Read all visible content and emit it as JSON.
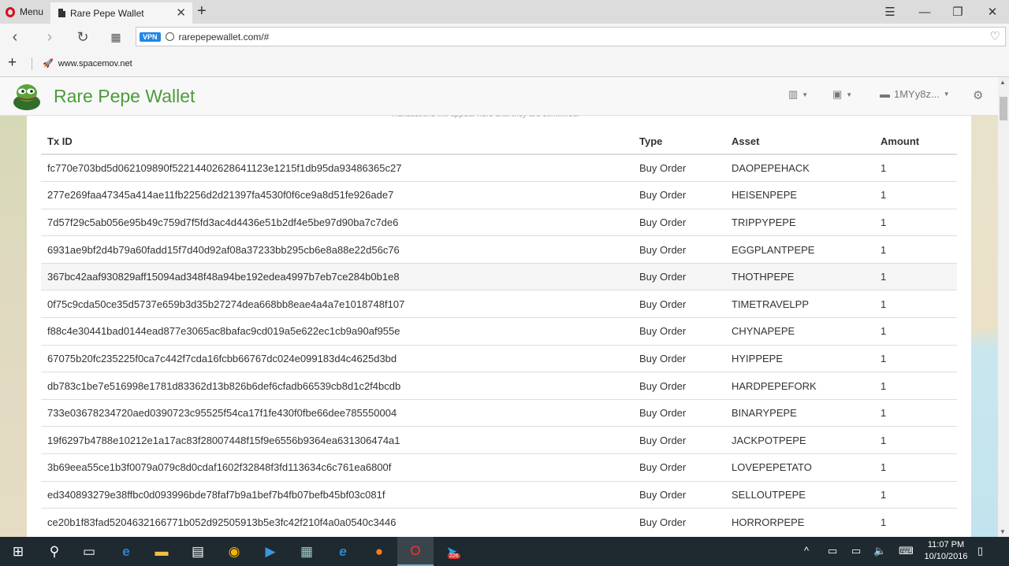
{
  "browser": {
    "menu_label": "Menu",
    "tab_title": "Rare Pepe Wallet",
    "url": "rarepepewallet.com/#",
    "vpn_label": "VPN",
    "bookmark": "www.spacemov.net"
  },
  "app": {
    "title": "Rare Pepe Wallet",
    "address_label": "1MYy8z...",
    "cut_text": "Transactions will appear here until they are confirmed."
  },
  "table": {
    "headers": [
      "Tx ID",
      "Type",
      "Asset",
      "Amount"
    ],
    "rows": [
      {
        "txid": "fc770e703bd5d062109890f52214402628641123e1215f1db95da93486365c27",
        "type": "Buy Order",
        "asset": "DAOPEPEHACK",
        "amount": "1"
      },
      {
        "txid": "277e269faa47345a414ae11fb2256d2d21397fa4530f0f6ce9a8d51fe926ade7",
        "type": "Buy Order",
        "asset": "HEISENPEPE",
        "amount": "1"
      },
      {
        "txid": "7d57f29c5ab056e95b49c759d7f5fd3ac4d4436e51b2df4e5be97d90ba7c7de6",
        "type": "Buy Order",
        "asset": "TRIPPYPEPE",
        "amount": "1"
      },
      {
        "txid": "6931ae9bf2d4b79a60fadd15f7d40d92af08a37233bb295cb6e8a88e22d56c76",
        "type": "Buy Order",
        "asset": "EGGPLANTPEPE",
        "amount": "1"
      },
      {
        "txid": "367bc42aaf930829aff15094ad348f48a94be192edea4997b7eb7ce284b0b1e8",
        "type": "Buy Order",
        "asset": "THOTHPEPE",
        "amount": "1"
      },
      {
        "txid": "0f75c9cda50ce35d5737e659b3d35b27274dea668bb8eae4a4a7e1018748f107",
        "type": "Buy Order",
        "asset": "TIMETRAVELPP",
        "amount": "1"
      },
      {
        "txid": "f88c4e30441bad0144ead877e3065ac8bafac9cd019a5e622ec1cb9a90af955e",
        "type": "Buy Order",
        "asset": "CHYNAPEPE",
        "amount": "1"
      },
      {
        "txid": "67075b20fc235225f0ca7c442f7cda16fcbb66767dc024e099183d4c4625d3bd",
        "type": "Buy Order",
        "asset": "HYIPPEPE",
        "amount": "1"
      },
      {
        "txid": "db783c1be7e516998e1781d83362d13b826b6def6cfadb66539cb8d1c2f4bcdb",
        "type": "Buy Order",
        "asset": "HARDPEPEFORK",
        "amount": "1"
      },
      {
        "txid": "733e03678234720aed0390723c95525f54ca17f1fe430f0fbe66dee785550004",
        "type": "Buy Order",
        "asset": "BINARYPEPE",
        "amount": "1"
      },
      {
        "txid": "19f6297b4788e10212e1a17ac83f28007448f15f9e6556b9364ea631306474a1",
        "type": "Buy Order",
        "asset": "JACKPOTPEPE",
        "amount": "1"
      },
      {
        "txid": "3b69eea55ce1b3f0079a079c8d0cdaf1602f32848f3fd113634c6c761ea6800f",
        "type": "Buy Order",
        "asset": "LOVEPEPETATO",
        "amount": "1"
      },
      {
        "txid": "ed340893279e38ffbc0d093996bde78faf7b9a1bef7b4fb07befb45bf03c081f",
        "type": "Buy Order",
        "asset": "SELLOUTPEPE",
        "amount": "1"
      },
      {
        "txid": "ce20b1f83fad5204632166771b052d92505913b5e3fc42f210f4a0a0540c3446",
        "type": "Buy Order",
        "asset": "HORRORPEPE",
        "amount": "1"
      }
    ]
  },
  "taskbar": {
    "time": "11:07 PM",
    "date": "10/10/2016",
    "telegram_badge": "226"
  },
  "colors": {
    "brand_green": "#4d9b3a",
    "taskbar": "#1f2a30",
    "opera_red": "#d4101c"
  }
}
